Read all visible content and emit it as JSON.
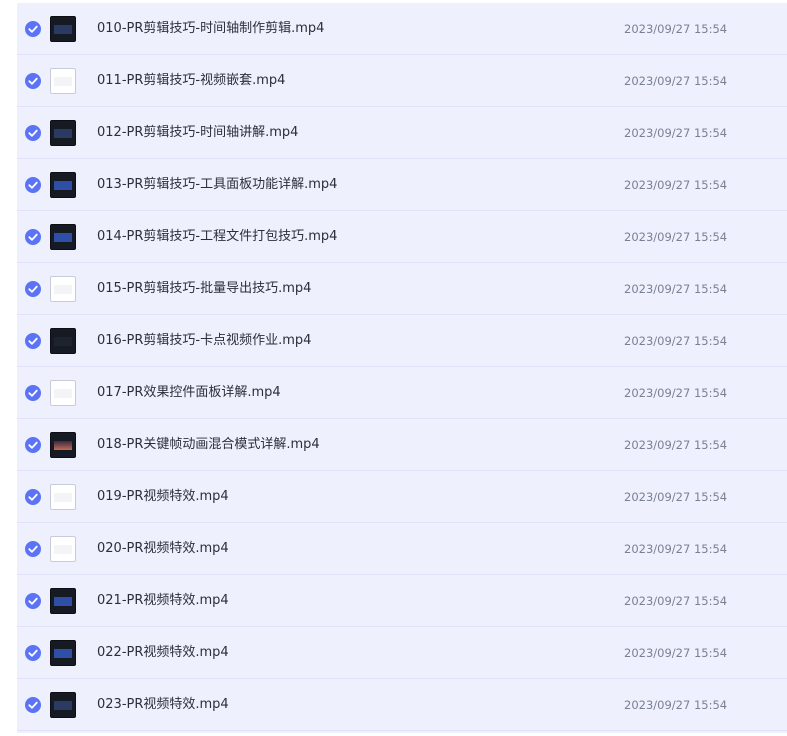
{
  "files": [
    {
      "name": "010-PR剪辑技巧-时间轴制作剪辑.mp4",
      "date": "2023/09/27 15:54",
      "selected": true,
      "thumb": "dark"
    },
    {
      "name": "011-PR剪辑技巧-视频嵌套.mp4",
      "date": "2023/09/27 15:54",
      "selected": true,
      "thumb": "light"
    },
    {
      "name": "012-PR剪辑技巧-时间轴讲解.mp4",
      "date": "2023/09/27 15:54",
      "selected": true,
      "thumb": "dark"
    },
    {
      "name": "013-PR剪辑技巧-工具面板功能详解.mp4",
      "date": "2023/09/27 15:54",
      "selected": true,
      "thumb": "dark blue"
    },
    {
      "name": "014-PR剪辑技巧-工程文件打包技巧.mp4",
      "date": "2023/09/27 15:54",
      "selected": true,
      "thumb": "dark blue"
    },
    {
      "name": "015-PR剪辑技巧-批量导出技巧.mp4",
      "date": "2023/09/27 15:54",
      "selected": true,
      "thumb": "light"
    },
    {
      "name": "016-PR剪辑技巧-卡点视频作业.mp4",
      "date": "2023/09/27 15:54",
      "selected": true,
      "thumb": "dark plain"
    },
    {
      "name": "017-PR效果控件面板详解.mp4",
      "date": "2023/09/27 15:54",
      "selected": true,
      "thumb": "light"
    },
    {
      "name": "018-PR关键帧动画混合模式详解.mp4",
      "date": "2023/09/27 15:54",
      "selected": true,
      "thumb": "dark sunset"
    },
    {
      "name": "019-PR视频特效.mp4",
      "date": "2023/09/27 15:54",
      "selected": true,
      "thumb": "light"
    },
    {
      "name": "020-PR视频特效.mp4",
      "date": "2023/09/27 15:54",
      "selected": true,
      "thumb": "light"
    },
    {
      "name": "021-PR视频特效.mp4",
      "date": "2023/09/27 15:54",
      "selected": true,
      "thumb": "dark blue"
    },
    {
      "name": "022-PR视频特效.mp4",
      "date": "2023/09/27 15:54",
      "selected": true,
      "thumb": "dark blue"
    },
    {
      "name": "023-PR视频特效.mp4",
      "date": "2023/09/27 15:54",
      "selected": true,
      "thumb": "dark"
    }
  ],
  "colors": {
    "row_selected_bg": "#eef0fd",
    "checkbox": "#5b73f5"
  },
  "icons": {
    "checkbox": "checkmark-icon",
    "thumbnail": "video-thumbnail-icon"
  }
}
